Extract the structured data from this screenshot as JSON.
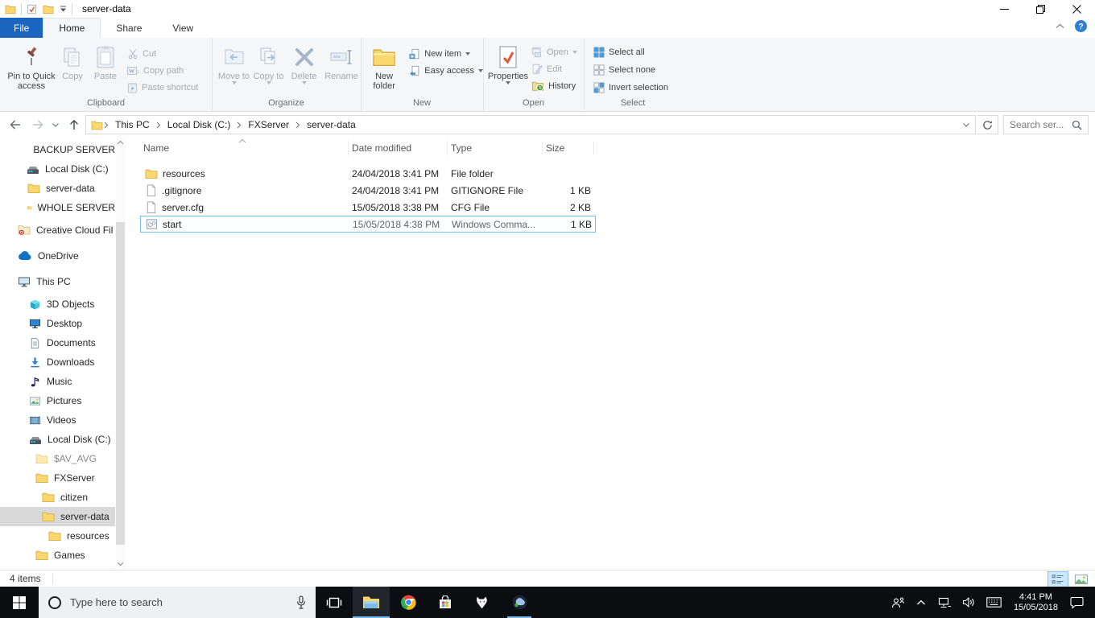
{
  "colors": {
    "accent_blue": "#1b65c0",
    "selection_border": "#7cc0ec",
    "taskbar_underline": "#76b9ed",
    "folder_yellow": "#f9d870",
    "sidebar_selected": "#d9d9d9"
  },
  "titlebar": {
    "title": "server-data"
  },
  "tabs": {
    "file": "File",
    "home": "Home",
    "share": "Share",
    "view": "View"
  },
  "ribbon": {
    "clipboard": {
      "label": "Clipboard",
      "pin": "Pin to Quick access",
      "copy": "Copy",
      "paste": "Paste",
      "cut": "Cut",
      "copy_path": "Copy path",
      "paste_shortcut": "Paste shortcut"
    },
    "organize": {
      "label": "Organize",
      "move_to": "Move to",
      "copy_to": "Copy to",
      "delete": "Delete",
      "rename": "Rename"
    },
    "new_group": {
      "label": "New",
      "new_folder": "New folder",
      "new_item": "New item",
      "easy_access": "Easy access"
    },
    "open_group": {
      "label": "Open",
      "properties": "Properties",
      "open": "Open",
      "edit": "Edit",
      "history": "History"
    },
    "select_group": {
      "label": "Select",
      "select_all": "Select all",
      "select_none": "Select none",
      "invert_selection": "Invert selection"
    }
  },
  "address": {
    "crumbs": [
      "This PC",
      "Local Disk (C:)",
      "FXServer",
      "server-data"
    ],
    "search_placeholder": "Search ser..."
  },
  "list": {
    "columns": [
      "Name",
      "Date modified",
      "Type",
      "Size"
    ],
    "files": [
      {
        "name": "resources",
        "date": "24/04/2018 3:41 PM",
        "type": "File folder",
        "size": ""
      },
      {
        "name": ".gitignore",
        "date": "24/04/2018 3:41 PM",
        "type": "GITIGNORE File",
        "size": "1 KB"
      },
      {
        "name": "server.cfg",
        "date": "15/05/2018 3:38 PM",
        "type": "CFG File",
        "size": "2 KB"
      },
      {
        "name": "start",
        "date": "15/05/2018 4:38 PM",
        "type": "Windows Comma...",
        "size": "1 KB"
      }
    ]
  },
  "sidebar": {
    "items": [
      {
        "label": "BACKUP SERVER"
      },
      {
        "label": "Local Disk (C:)"
      },
      {
        "label": "server-data"
      },
      {
        "label": "WHOLE SERVER"
      },
      {
        "label": "Creative Cloud Fil"
      },
      {
        "label": "OneDrive"
      },
      {
        "label": "This PC"
      },
      {
        "label": "3D Objects"
      },
      {
        "label": "Desktop"
      },
      {
        "label": "Documents"
      },
      {
        "label": "Downloads"
      },
      {
        "label": "Music"
      },
      {
        "label": "Pictures"
      },
      {
        "label": "Videos"
      },
      {
        "label": "Local Disk (C:)"
      },
      {
        "label": "$AV_AVG"
      },
      {
        "label": "FXServer"
      },
      {
        "label": "citizen"
      },
      {
        "label": "server-data"
      },
      {
        "label": "resources"
      },
      {
        "label": "Games"
      }
    ]
  },
  "statusbar": {
    "items_count": "4 items"
  },
  "taskbar": {
    "search_placeholder": "Type here to search",
    "time": "4:41 PM",
    "date": "15/05/2018"
  }
}
